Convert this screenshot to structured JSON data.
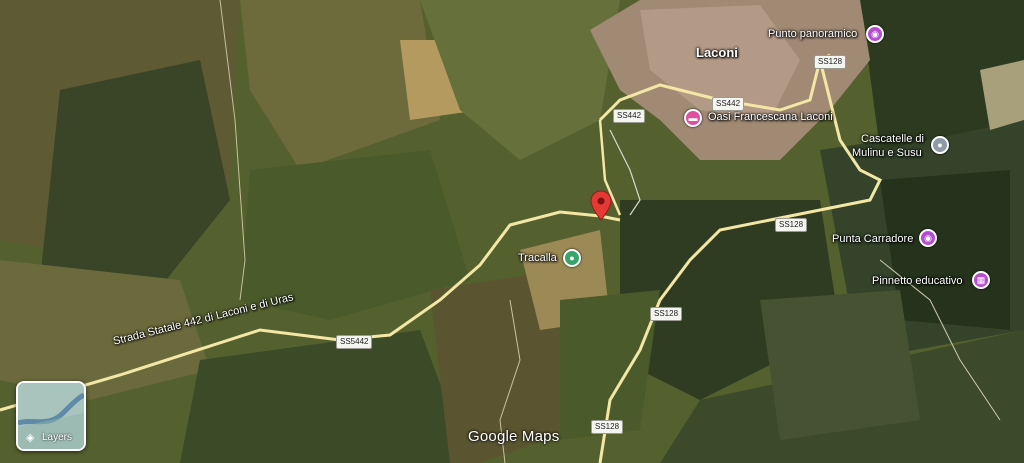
{
  "map": {
    "town": "Laconi",
    "pois": [
      {
        "label": "Punto panoramico",
        "icon": "camera-icon",
        "color": "#b54dd0"
      },
      {
        "label": "Oasi Francescana Laconi",
        "icon": "hotel-icon",
        "color": "#e050a0"
      },
      {
        "label": "Cascatelle di",
        "icon": "place-icon",
        "color": "#8e9aa5"
      },
      {
        "label": "Mulinu e Susu"
      },
      {
        "label": "Punta Carradore",
        "icon": "camera-icon",
        "color": "#b54dd0"
      },
      {
        "label": "Pinnetto educativo",
        "icon": "museum-icon",
        "color": "#b54dd0"
      },
      {
        "label": "Tracalla",
        "icon": "farm-icon",
        "color": "#3aa56a"
      }
    ],
    "road_name": "Strada Statale 442 di Laconi e di Uras",
    "shields": [
      "SS128",
      "SS442",
      "SS442",
      "SS128",
      "SS128",
      "SS5442",
      "SS128"
    ],
    "pin_color": "#e53935",
    "road_color": "#f3e7a6"
  },
  "controls": {
    "layers_label": "Layers",
    "brand": "Google Maps"
  }
}
